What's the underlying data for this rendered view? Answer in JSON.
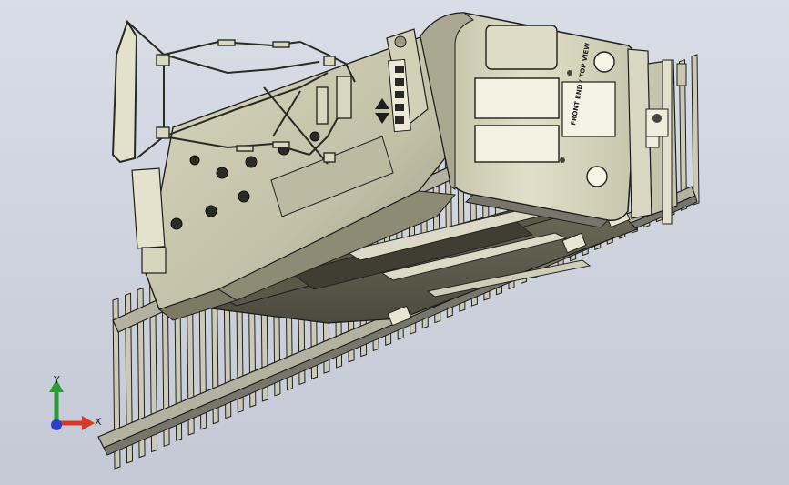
{
  "viewport": {
    "background_top": "#d9dde6",
    "background_bottom": "#c4c9d5"
  },
  "model": {
    "body_color": "#c9c7ad",
    "shadow_color": "#8d8b73",
    "outline_color": "#1e1e1e",
    "rail_color": "#a7a795",
    "door_text": "FRONT END / TOP VIEW"
  },
  "triad": {
    "x_label": "X",
    "y_label": "Y",
    "x_color": "#d23a2a",
    "y_color": "#2f9a3a",
    "z_color": "#2b3fcf"
  }
}
